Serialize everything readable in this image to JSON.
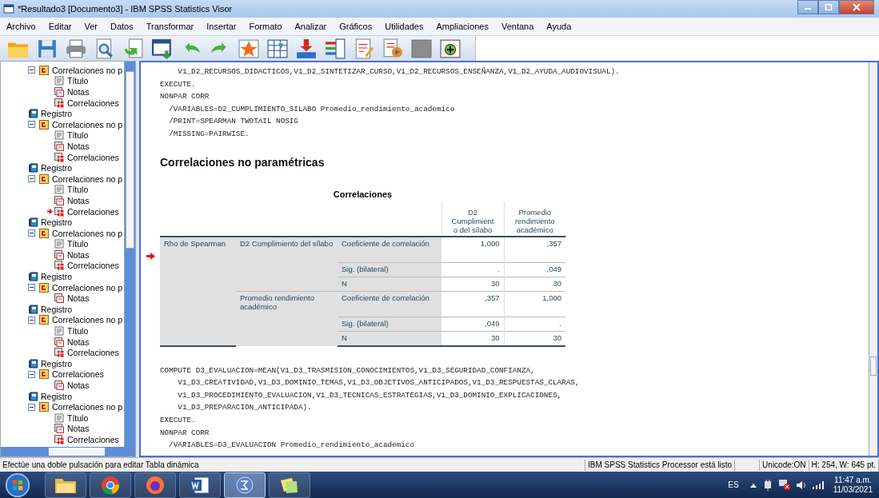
{
  "window": {
    "title": "*Resultado3 [Documento3] - IBM SPSS Statistics Visor"
  },
  "menu": [
    "Archivo",
    "Editar",
    "Ver",
    "Datos",
    "Transformar",
    "Insertar",
    "Formato",
    "Analizar",
    "Gráficos",
    "Utilidades",
    "Ampliaciones",
    "Ventana",
    "Ayuda"
  ],
  "outline": {
    "items": [
      {
        "label": "Correlaciones no p",
        "kind": "output",
        "expanded": true,
        "children": [
          {
            "label": "Título",
            "kind": "title",
            "current": false
          },
          {
            "label": "Notas",
            "kind": "notes",
            "current": false
          },
          {
            "label": "Correlaciones",
            "kind": "table",
            "current": false
          }
        ]
      },
      {
        "label": "Registro",
        "kind": "log"
      },
      {
        "label": "Correlaciones no p",
        "kind": "output",
        "expanded": true,
        "children": [
          {
            "label": "Título",
            "kind": "title",
            "current": false
          },
          {
            "label": "Notas",
            "kind": "notes",
            "current": false
          },
          {
            "label": "Correlaciones",
            "kind": "table",
            "current": false
          }
        ]
      },
      {
        "label": "Registro",
        "kind": "log"
      },
      {
        "label": "Correlaciones no p",
        "kind": "output",
        "expanded": true,
        "children": [
          {
            "label": "Título",
            "kind": "title",
            "current": false
          },
          {
            "label": "Notas",
            "kind": "notes",
            "current": false
          },
          {
            "label": "Correlaciones",
            "kind": "table",
            "current": true
          }
        ]
      },
      {
        "label": "Registro",
        "kind": "log"
      },
      {
        "label": "Correlaciones no p",
        "kind": "output",
        "expanded": true,
        "children": [
          {
            "label": "Título",
            "kind": "title",
            "current": false
          },
          {
            "label": "Notas",
            "kind": "notes",
            "current": false
          },
          {
            "label": "Correlaciones",
            "kind": "table",
            "current": false
          }
        ]
      },
      {
        "label": "Registro",
        "kind": "log"
      },
      {
        "label": "Correlaciones no p",
        "kind": "output",
        "expanded": true,
        "children": [
          {
            "label": "Notas",
            "kind": "notes",
            "current": false
          }
        ]
      },
      {
        "label": "Registro",
        "kind": "log"
      },
      {
        "label": "Correlaciones no p",
        "kind": "output",
        "expanded": true,
        "children": [
          {
            "label": "Título",
            "kind": "title",
            "current": false
          },
          {
            "label": "Notas",
            "kind": "notes",
            "current": false
          },
          {
            "label": "Correlaciones",
            "kind": "table",
            "current": false
          }
        ]
      },
      {
        "label": "Registro",
        "kind": "log"
      },
      {
        "label": "Correlaciones",
        "kind": "output",
        "expanded": true,
        "children": [
          {
            "label": "Notas",
            "kind": "notes",
            "current": false
          }
        ]
      },
      {
        "label": "Registro",
        "kind": "log"
      },
      {
        "label": "Correlaciones no p",
        "kind": "output",
        "expanded": true,
        "children": [
          {
            "label": "Título",
            "kind": "title",
            "current": false
          },
          {
            "label": "Notas",
            "kind": "notes",
            "current": false
          },
          {
            "label": "Correlaciones",
            "kind": "table",
            "current": false
          }
        ]
      }
    ]
  },
  "viewer": {
    "syntax_top": [
      "    V1_D2_RECURSOS_DIDACTICOS,V1_D2_SINTETIZAR_CURSO,V1_D2_RECURSOS_ENSEÑANZA,V1_D2_AYUDA_AUDIOVISUAL).",
      "EXECUTE.",
      "NONPAR CORR",
      "  /VARIABLES=D2_CUMPLIMIENTO_SILABO Promedio_rendimiento_academico",
      "  /PRINT=SPEARMAN TWOTAIL NOSIG",
      "  /MISSING=PAIRWISE."
    ],
    "heading": "Correlaciones no paramétricas",
    "table": {
      "title": "Correlaciones",
      "columns": [
        [
          "D2",
          "Cumplimient",
          "o del sílabo"
        ],
        [
          "Promedio",
          "rendimiento",
          "académico"
        ]
      ],
      "row_header": "Rho de Spearman",
      "selected": true,
      "variables": [
        {
          "label": "D2 Cumplimiento del sílabo",
          "stats": [
            {
              "label": "Coeficiente de correlación",
              "values": [
                "1,000",
                ",357"
              ]
            },
            {
              "label": "Sig. (bilateral)",
              "values": [
                ".",
                ",049"
              ]
            },
            {
              "label": "N",
              "values": [
                "30",
                "30"
              ]
            }
          ]
        },
        {
          "label": "Promedio rendimiento académico",
          "stats": [
            {
              "label": "Coeficiente de correlación",
              "values": [
                ",357",
                "1,000"
              ]
            },
            {
              "label": "Sig. (bilateral)",
              "values": [
                ",049",
                "."
              ]
            },
            {
              "label": "N",
              "values": [
                "30",
                "30"
              ]
            }
          ]
        }
      ]
    },
    "syntax_bottom": [
      "COMPUTE D3_EVALUACION=MEAN(V1_D3_TRASMISION_CONOCIMIENTOS,V1_D3_SEGURIDAD_CONFIANZA,",
      "    V1_D3_CREATIVIDAD,V1_D3_DOMINIO_TEMAS,V1_D3_OBJETIVOS_ANTICIPADOS,V1_D3_RESPUESTAS_CLARAS,",
      "    V1_D3_PROCEDIMIENTO_EVALUACION,V1_D3_TECNICAS_ESTRATEGIAS,V1_D3_DOMINIO_EXPLICACIONES,",
      "    V1_D3_PREPARACION_ANTICIPADA).",
      "EXECUTE.",
      "NONPAR CORR",
      "  /VARIABLES=D3_EVALUACION Promedio_rendimiento_academico"
    ]
  },
  "status_bar": {
    "message": "Efectúe una doble pulsación para editar Tabla dinámica",
    "processor": "IBM SPSS Statistics Processor está listo",
    "unicode": "Unicode:ON",
    "size": "H: 254, W: 645 pt."
  },
  "taskbar": {
    "apps": [
      {
        "kind": "folder",
        "selected": false
      },
      {
        "kind": "chrome",
        "selected": false
      },
      {
        "kind": "firefox",
        "selected": false
      },
      {
        "kind": "word",
        "selected": false
      },
      {
        "kind": "math",
        "selected": true
      },
      {
        "kind": "notes",
        "selected": false
      }
    ],
    "language": "ES",
    "time": "11:47 a.m.",
    "date": "11/03/2021"
  }
}
